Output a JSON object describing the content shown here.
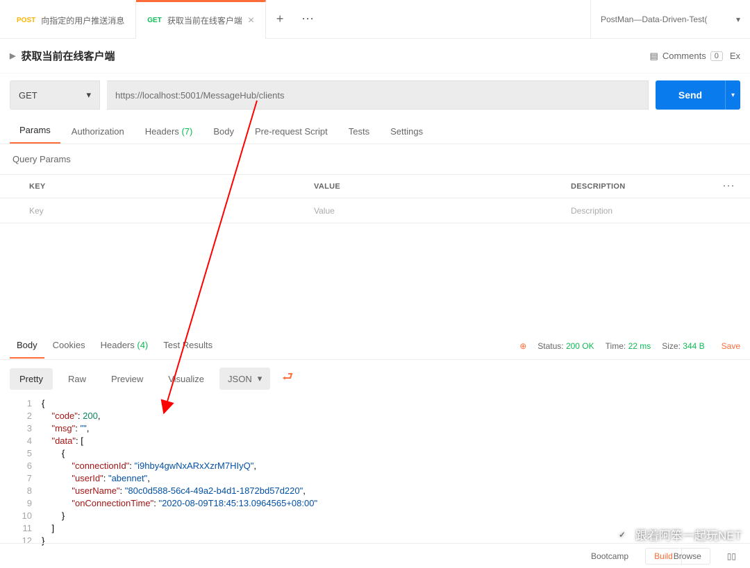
{
  "tabs": [
    {
      "method": "POST",
      "methodClass": "method-post",
      "title": "向指定的用户推送消息"
    },
    {
      "method": "GET",
      "methodClass": "method-get",
      "title": "获取当前在线客户端"
    }
  ],
  "env": {
    "name": "PostMan—Data-Driven-Test("
  },
  "request": {
    "name": "获取当前在线客户端",
    "method": "GET",
    "url": "https://localhost:5001/MessageHub/clients"
  },
  "header": {
    "comments": "Comments",
    "commentsCount": "0",
    "ex": "Ex"
  },
  "send": {
    "label": "Send"
  },
  "reqTabs": {
    "params": "Params",
    "auth": "Authorization",
    "headers": "Headers",
    "headersCount": "(7)",
    "body": "Body",
    "prereq": "Pre-request Script",
    "tests": "Tests",
    "settings": "Settings"
  },
  "queryParamsLabel": "Query Params",
  "paramsHeader": {
    "key": "KEY",
    "value": "VALUE",
    "desc": "DESCRIPTION"
  },
  "paramsPlaceholder": {
    "key": "Key",
    "value": "Value",
    "desc": "Description"
  },
  "respTabs": {
    "body": "Body",
    "cookies": "Cookies",
    "headers": "Headers",
    "headersCount": "(4)",
    "test": "Test Results"
  },
  "respStatus": {
    "statusLabel": "Status:",
    "status": "200 OK",
    "timeLabel": "Time:",
    "time": "22 ms",
    "sizeLabel": "Size:",
    "size": "344 B",
    "save": "Save"
  },
  "bodyToolbar": {
    "pretty": "Pretty",
    "raw": "Raw",
    "preview": "Preview",
    "visualize": "Visualize",
    "format": "JSON"
  },
  "responseBody": {
    "code": 200,
    "msg": "",
    "data": [
      {
        "connectionId": "i9hby4gwNxARxXzrM7HIyQ",
        "userId": "abennet",
        "userName": "80c0d588-56c4-49a2-b4d1-1872bd57d220",
        "onConnectionTime": "2020-08-09T18:45:13.0964565+08:00"
      }
    ]
  },
  "footer": {
    "bootcamp": "Bootcamp",
    "build": "Build",
    "browse": "Browse"
  },
  "watermark": "跟着阿笨一起玩NET"
}
